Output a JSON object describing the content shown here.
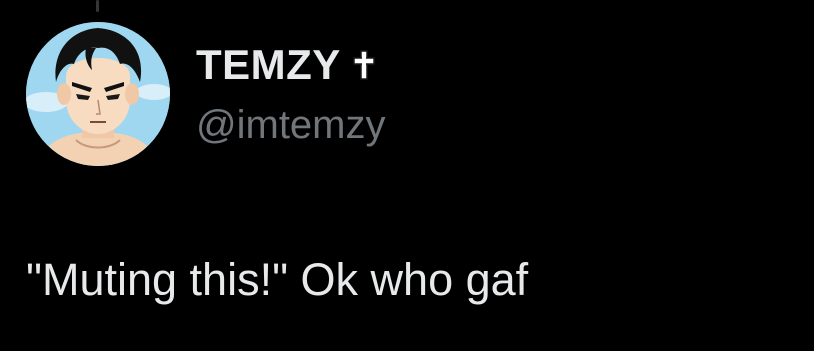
{
  "tweet": {
    "author": {
      "display_name": "TEMZY",
      "handle": "@imtemzy",
      "name_emoji_icon": "latin-cross-icon",
      "avatar_icon": "anime-character-avatar"
    },
    "text": "\"Muting this!\" Ok who gaf"
  },
  "colors": {
    "background": "#000000",
    "primary_text": "#e7e9ea",
    "secondary_text": "#71767b",
    "thread_line": "#333639"
  }
}
